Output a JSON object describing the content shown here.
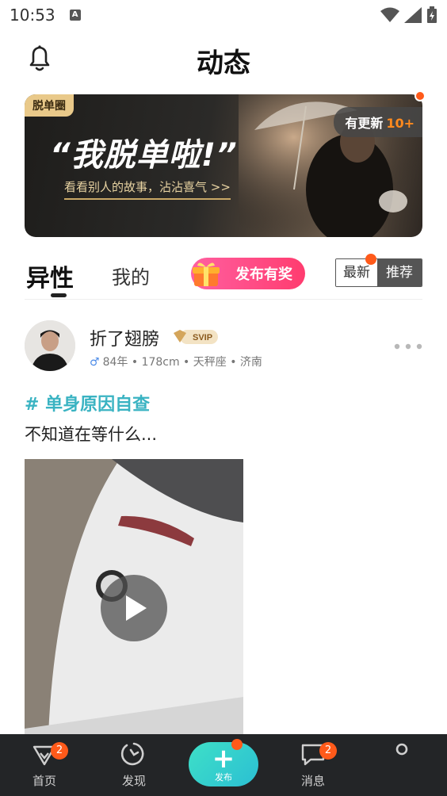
{
  "status_bar": {
    "time": "10:53",
    "notification_letter": "A"
  },
  "header": {
    "title": "动态"
  },
  "banner": {
    "tag": "脱单圈",
    "headline": "“我脱单啦!”",
    "subline": "看看别人的故事，沾沾喜气 >>",
    "update_label": "有更新",
    "update_count": "10+"
  },
  "tabs": {
    "active": "异性",
    "mine": "我的",
    "reward_button": "发布有奖",
    "sort_latest": "最新",
    "sort_recommended": "推荐"
  },
  "post": {
    "username": "折了翅膀",
    "vip_label": "SVIP",
    "gender_symbol": "♂",
    "meta": "84年 • 178cm • 天秤座 • 济南",
    "topic": "# 单身原因自查",
    "text": "不知道在等什么..."
  },
  "bottom_nav": {
    "home": {
      "label": "首页",
      "badge": "2"
    },
    "discover": {
      "label": "发现"
    },
    "publish": {
      "label": "发布"
    },
    "messages": {
      "label": "消息",
      "badge": "2"
    }
  },
  "colors": {
    "accent_teal": "#3ab3c2",
    "badge_orange": "#ff5a1a",
    "reward_pink": "#ff3c6f",
    "nav_bg": "#232527"
  }
}
